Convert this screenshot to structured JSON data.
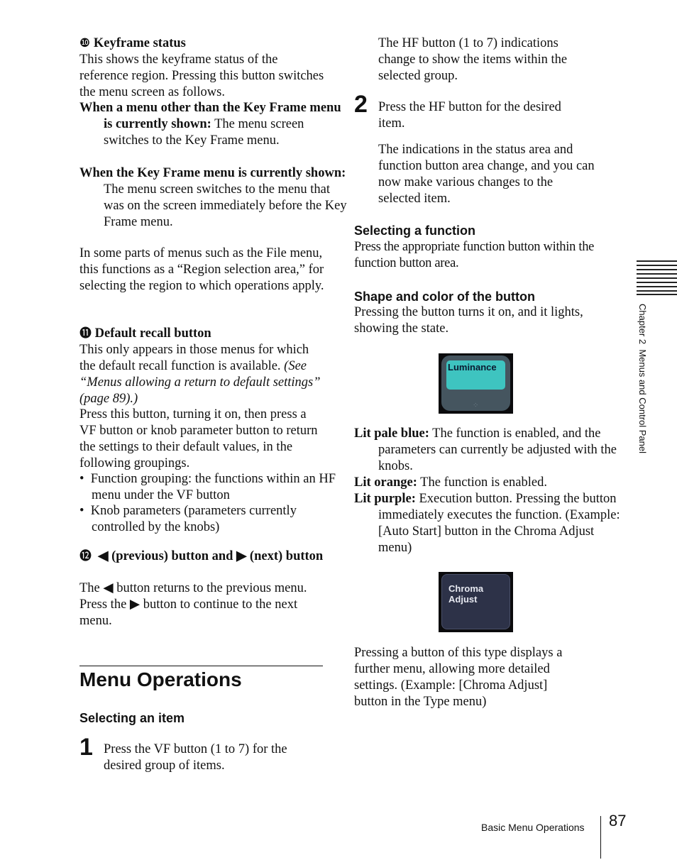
{
  "left": {
    "item10": {
      "number": "❿",
      "title": "Keyframe status",
      "intro": "This shows the keyframe status of the reference region. Pressing this button switches the menu screen as follows.",
      "case1_term": "When a menu other than the Key Frame menu is currently shown:",
      "case1_text": " The menu screen switches to the Key Frame menu.",
      "case2_term": "When the Key Frame menu is currently shown:",
      "case2_text": " The menu screen switches to the menu that was on the screen immediately before the Key Frame menu.",
      "note": "In some parts of menus such as the File menu, this functions as a “Region selection area,” for selecting the region to which operations apply."
    },
    "item11": {
      "number": "⓫",
      "title": "Default recall button",
      "p1": "This only appears in those menus for which the default recall function is available. ",
      "p1_ref": "(See “Menus allowing a return to default settings” (page 89).)",
      "p2": "Press this button, turning it on, then press a VF button or knob parameter button to return the settings to their default values, in the following groupings.",
      "bullets": [
        "Function grouping: the functions within an HF menu under the VF button",
        "Knob parameters (parameters currently controlled by the knobs)"
      ]
    },
    "item12": {
      "number": "⓬",
      "title": "◀ (previous) button and ▶ (next) button",
      "text": "The ◀ button returns to the previous menu. Press the ▶ button to continue to the next menu."
    },
    "section_title": "Menu Operations",
    "sub1": "Selecting an item",
    "step1_num": "1",
    "step1_text": "Press the VF button (1 to 7) for the desired group of items."
  },
  "right": {
    "step1_note": "The HF button (1 to 7) indications change to show the items within the selected group.",
    "step2_num": "2",
    "step2_text": "Press the HF button for the desired item.",
    "step2_note": "The indications in the status area and function button area change, and you can now make various changes to the selected item.",
    "sub2": "Selecting a function",
    "sub2_text": "Press the appropriate function button within the function button area.",
    "sub3": "Shape and color of the button",
    "sub3_text": "Pressing the button turns it on, and it lights, showing the state.",
    "button1_label": "Luminance",
    "lit1_term": "Lit pale blue:",
    "lit1_text": " The function is enabled, and the parameters can currently be adjusted with the knobs.",
    "lit2_term": "Lit orange:",
    "lit2_text": " The function is enabled.",
    "lit3_term": "Lit purple:",
    "lit3_text": " Execution button. Pressing the button immediately executes the function. (Example: [Auto Start] button in the Chroma Adjust menu)",
    "button2_label_1": "Chroma",
    "button2_label_2": "Adjust",
    "final": "Pressing a button of this type displays a further menu, allowing more detailed settings. (Example: [Chroma Adjust] button in the Type menu)"
  },
  "side_tab": "Chapter 2  Menus and Control Panel",
  "footer": {
    "section": "Basic Menu Operations",
    "page": "87"
  },
  "colors": {
    "lit_blue": "#3ec4c0",
    "button_dark": "#2d3248"
  }
}
